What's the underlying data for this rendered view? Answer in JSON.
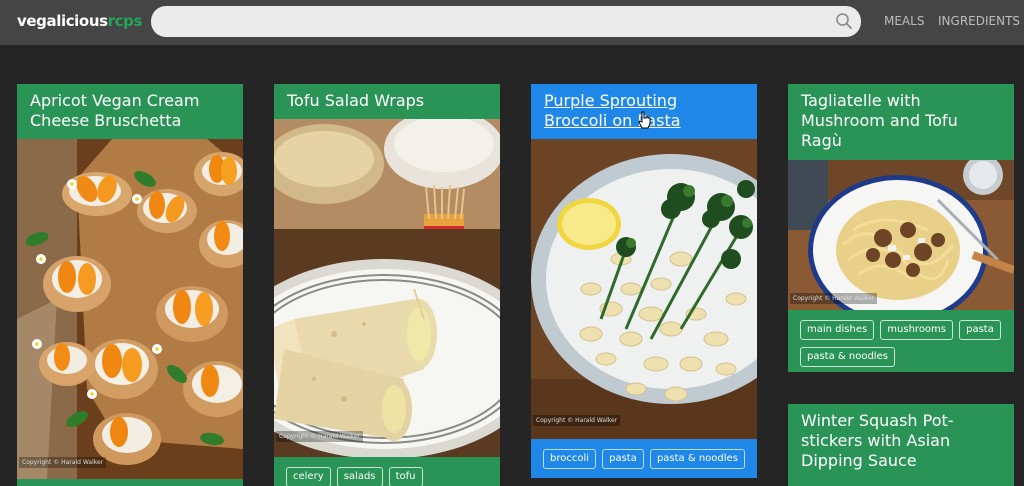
{
  "header": {
    "logo_main": "vegalicious",
    "logo_accent": "rcps",
    "search_placeholder": "",
    "nav": [
      "MEALS",
      "INGREDIENTS"
    ]
  },
  "cards": [
    {
      "title": "Apricot Vegan Cream Cheese Bruschetta",
      "image": "bruschetta-photo",
      "copyright": "Copyright © Harald Walker",
      "tags": []
    },
    {
      "title": "Tofu Salad Wraps",
      "image": "tofu-wraps-photo",
      "copyright": "Copyright © Harald Walker",
      "tags": [
        "celery",
        "salads",
        "tofu"
      ]
    },
    {
      "title": "Purple Sprouting Broccoli on Pasta",
      "image": "broccoli-pasta-photo",
      "copyright": "Copyright © Harald Walker",
      "tags": [
        "broccoli",
        "pasta",
        "pasta & noodles"
      ],
      "hovered": true
    },
    {
      "title": "Tagliatelle with Mushroom and Tofu Ragù",
      "image": "tagliatelle-photo",
      "copyright": "Copyright © Harald Walker",
      "tags": [
        "main dishes",
        "mushrooms",
        "pasta",
        "pasta & noodles"
      ]
    },
    {
      "title": "Winter Squash Pot-stickers with Asian Dipping Sauce",
      "image": "potstickers-photo",
      "tags": []
    }
  ],
  "colors": {
    "page_bg": "#252525",
    "header_bg": "#454545",
    "card_green": "#2a9457",
    "card_blue": "#1e87e8",
    "logo_accent": "#27a35c"
  }
}
